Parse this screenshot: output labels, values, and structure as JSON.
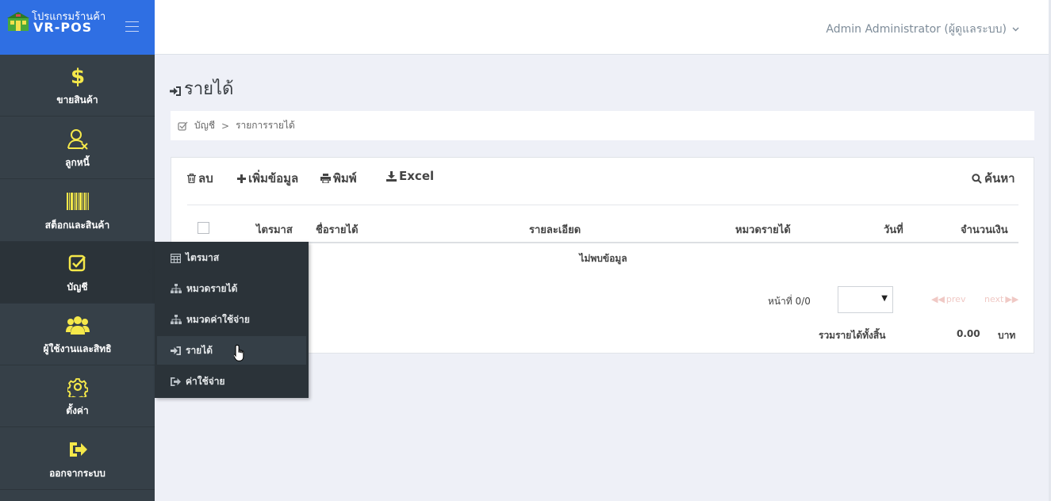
{
  "brand": {
    "line1": "โปรแกรมร้านค้า",
    "line2": "VR-POS",
    "logo_icon": "shop-logo-icon",
    "menu_icon": "hamburger-icon"
  },
  "sidebar": {
    "items": [
      {
        "label": "ขายสินค้า",
        "icon": "dollar-icon"
      },
      {
        "label": "ลูกหนี้",
        "icon": "user-x-icon"
      },
      {
        "label": "สต็อกและสินค้า",
        "icon": "barcode-icon"
      },
      {
        "label": "บัญชี",
        "icon": "check-square-icon",
        "active": true
      },
      {
        "label": "ผู้ใช้งานและสิทธิ",
        "icon": "users-icon"
      },
      {
        "label": "ตั้งค่า",
        "icon": "gear-icon"
      },
      {
        "label": "ออกจากระบบ",
        "icon": "sign-out-icon"
      }
    ],
    "accent_color": "#f5e84a"
  },
  "submenu": {
    "items": [
      {
        "label": "ไตรมาส",
        "icon": "calendar-icon"
      },
      {
        "label": "หมวดรายได้",
        "icon": "sitemap-icon"
      },
      {
        "label": "หมวดค่าใช้จ่าย",
        "icon": "sitemap-icon"
      },
      {
        "label": "รายได้",
        "icon": "sign-in-icon",
        "hovered": true
      },
      {
        "label": "ค่าใช้จ่าย",
        "icon": "sign-out-icon"
      }
    ]
  },
  "topbar": {
    "user": "Admin Administrator (ผู้ดูแลระบบ)",
    "caret_icon": "chevron-down-icon"
  },
  "page": {
    "title": "รายได้",
    "title_icon": "sign-in-icon"
  },
  "breadcrumb": {
    "root": "บัญชี",
    "current": "รายการรายได้",
    "separator": ">"
  },
  "toolbar": {
    "delete": "ลบ",
    "add": "เพิ่มข้อมูล",
    "print": "พิมพ์",
    "excel": "Excel",
    "search": "ค้นหา"
  },
  "table": {
    "headers": [
      "ไตรมาส",
      "ชื่อรายได้",
      "รายละเอียด",
      "หมวดรายได้",
      "วันที่",
      "จำนวนเงิน"
    ],
    "empty_text": "ไม่พบข้อมูล"
  },
  "pagination": {
    "page_label": "หน้าที่ 0/0",
    "selected": "",
    "prev": "prev",
    "next": "next"
  },
  "totals": {
    "label": "รวมรายได้ทั้งสิ้น",
    "value": "0.00",
    "unit": "บาท"
  },
  "colors": {
    "brand_blue": "#2f6fe3",
    "sidebar_bg": "#364048",
    "page_bg": "#eef0f7"
  }
}
